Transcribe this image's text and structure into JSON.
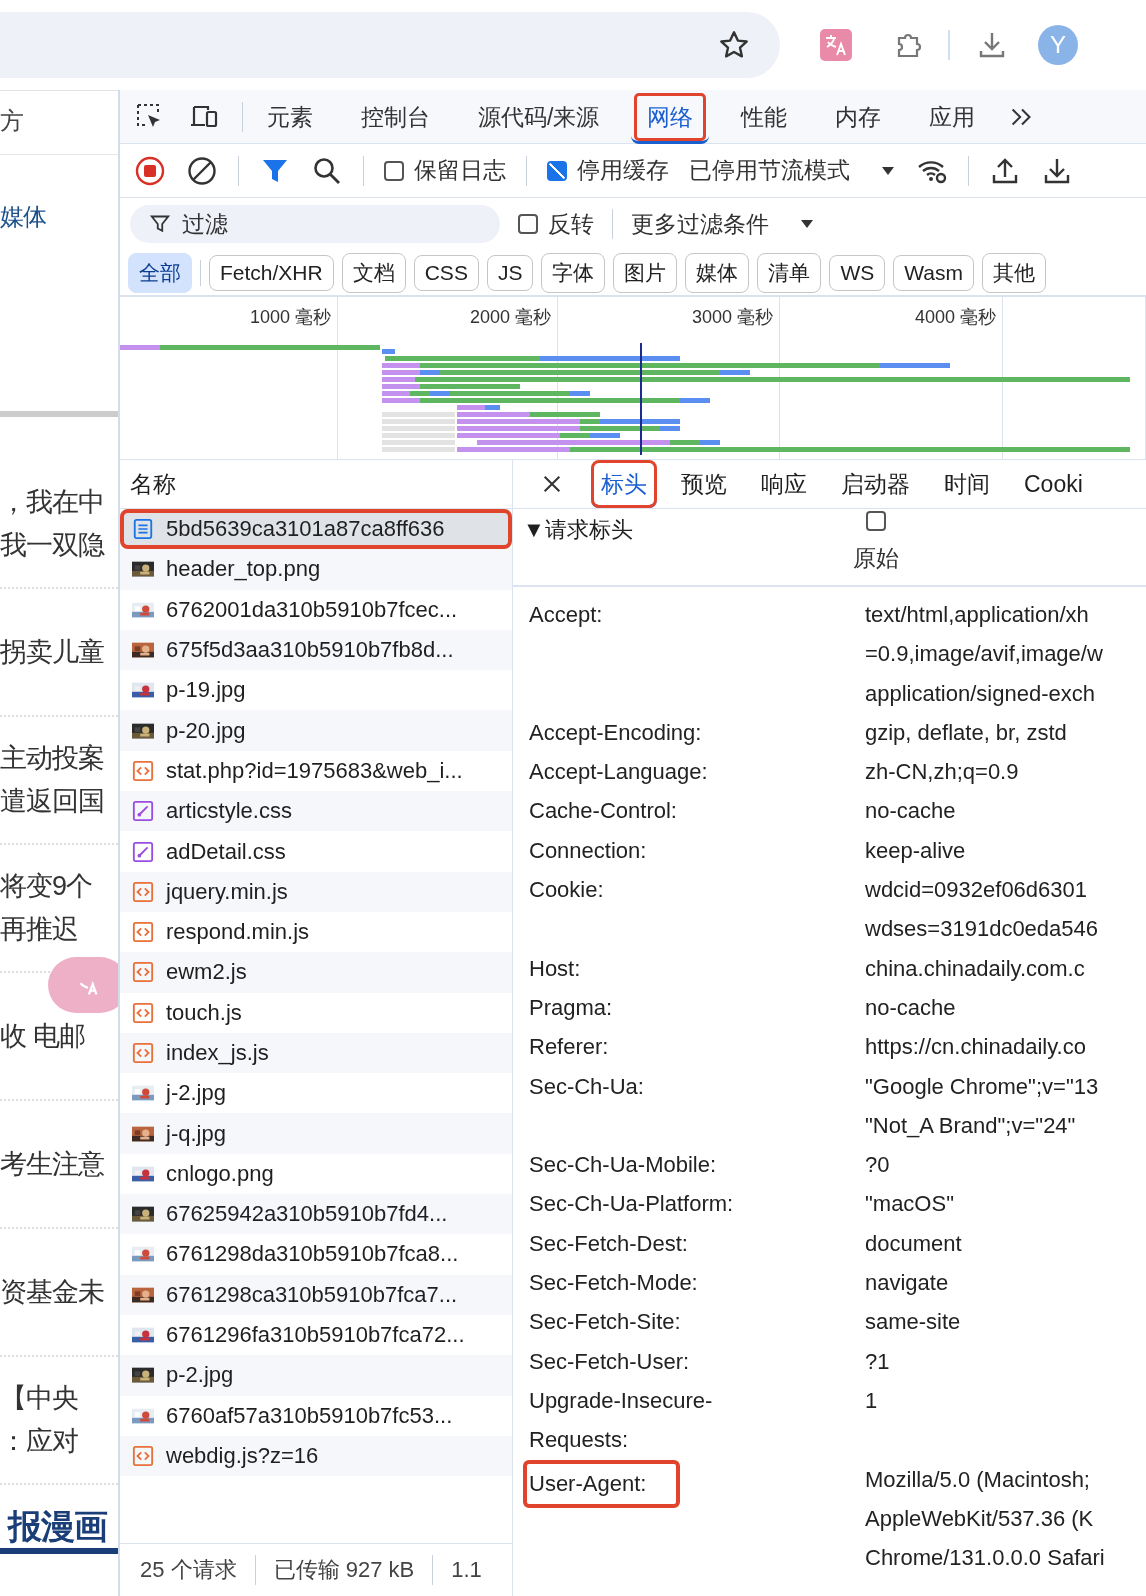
{
  "browser": {
    "avatar": "Y"
  },
  "page_fragments": [
    {
      "lines": [
        "方"
      ],
      "kind": "nav"
    },
    {
      "lines": [
        "媒体"
      ],
      "kind": "link"
    },
    {
      "kind": "rule"
    },
    {
      "lines": [
        "，我在中",
        "我一双隐"
      ],
      "kind": "headline"
    },
    {
      "lines": [
        "拐卖儿童"
      ],
      "kind": "headline"
    },
    {
      "lines": [
        "主动投案",
        "遣返回国"
      ],
      "kind": "headline"
    },
    {
      "lines": [
        "将变9个",
        "再推迟"
      ],
      "kind": "headline"
    },
    {
      "lines": [
        "收 电邮"
      ],
      "kind": "headline"
    },
    {
      "lines": [
        "考生注意"
      ],
      "kind": "headline"
    },
    {
      "lines": [
        "资基金未"
      ],
      "kind": "headline"
    },
    {
      "lines": [
        "【中央",
        "：应对"
      ],
      "kind": "headline"
    },
    {
      "lines": [
        "报漫画"
      ],
      "kind": "banner"
    }
  ],
  "devtools": {
    "panels": [
      {
        "label": "元素",
        "selected": false,
        "annotated": false
      },
      {
        "label": "控制台",
        "selected": false,
        "annotated": false
      },
      {
        "label": "源代码/来源",
        "selected": false,
        "annotated": false
      },
      {
        "label": "网络",
        "selected": true,
        "annotated": true
      },
      {
        "label": "性能",
        "selected": false,
        "annotated": false
      },
      {
        "label": "内存",
        "selected": false,
        "annotated": false
      },
      {
        "label": "应用",
        "selected": false,
        "annotated": false
      }
    ],
    "toolbar": {
      "preserve_log": {
        "label": "保留日志",
        "checked": false
      },
      "disable_cache": {
        "label": "停用缓存",
        "checked": true
      },
      "throttling": "已停用节流模式"
    },
    "filter": {
      "placeholder": "过滤",
      "invert": {
        "label": "反转",
        "checked": false
      },
      "more_filters": "更多过滤条件"
    },
    "type_filters": [
      {
        "label": "全部",
        "selected": true
      },
      {
        "label": "Fetch/XHR",
        "selected": false
      },
      {
        "label": "文档",
        "selected": false
      },
      {
        "label": "CSS",
        "selected": false
      },
      {
        "label": "JS",
        "selected": false
      },
      {
        "label": "字体",
        "selected": false
      },
      {
        "label": "图片",
        "selected": false
      },
      {
        "label": "媒体",
        "selected": false
      },
      {
        "label": "清单",
        "selected": false
      },
      {
        "label": "WS",
        "selected": false
      },
      {
        "label": "Wasm",
        "selected": false
      },
      {
        "label": "其他",
        "selected": false
      }
    ],
    "timeline_ticks": [
      "1000 毫秒",
      "2000 毫秒",
      "3000 毫秒",
      "4000 毫秒"
    ],
    "requests": {
      "column": "名称",
      "items": [
        {
          "name": "5bd5639ca3101a87ca8ff636",
          "kind": "document",
          "selected": true,
          "annotated": true
        },
        {
          "name": "header_top.png",
          "selected": false,
          "annotated": false
        },
        {
          "name": "6762001da310b5910b7fcec...",
          "selected": false,
          "annotated": false
        },
        {
          "name": "675f5d3aa310b5910b7fb8d...",
          "selected": false,
          "annotated": false
        },
        {
          "name": "p-19.jpg",
          "selected": false,
          "annotated": false
        },
        {
          "name": "p-20.jpg",
          "selected": false,
          "annotated": false
        },
        {
          "name": "stat.php?id=1975683&web_i...",
          "kind": "script",
          "selected": false,
          "annotated": false
        },
        {
          "name": "articstyle.css",
          "kind": "stylesheet",
          "selected": false,
          "annotated": false
        },
        {
          "name": "adDetail.css",
          "kind": "stylesheet",
          "selected": false,
          "annotated": false
        },
        {
          "name": "jquery.min.js",
          "kind": "script",
          "selected": false,
          "annotated": false
        },
        {
          "name": "respond.min.js",
          "kind": "script",
          "selected": false,
          "annotated": false
        },
        {
          "name": "ewm2.js",
          "kind": "script",
          "selected": false,
          "annotated": false
        },
        {
          "name": "touch.js",
          "kind": "script",
          "selected": false,
          "annotated": false
        },
        {
          "name": "index_js.js",
          "kind": "script",
          "selected": false,
          "annotated": false
        },
        {
          "name": "j-2.jpg",
          "selected": false,
          "annotated": false
        },
        {
          "name": "j-q.jpg",
          "selected": false,
          "annotated": false
        },
        {
          "name": "cnlogo.png",
          "selected": false,
          "annotated": false
        },
        {
          "name": "67625942a310b5910b7fd4...",
          "selected": false,
          "annotated": false
        },
        {
          "name": "6761298da310b5910b7fca8...",
          "selected": false,
          "annotated": false
        },
        {
          "name": "6761298ca310b5910b7fca7...",
          "selected": false,
          "annotated": false
        },
        {
          "name": "6761296fa310b5910b7fca72...",
          "selected": false,
          "annotated": false
        },
        {
          "name": "p-2.jpg",
          "selected": false,
          "annotated": false
        },
        {
          "name": "6760af57a310b5910b7fc53...",
          "selected": false,
          "annotated": false
        },
        {
          "name": "webdig.js?z=16",
          "kind": "script",
          "selected": false,
          "annotated": false
        }
      ]
    },
    "status_bar": [
      "25 个请求",
      "已传输 927 kB",
      "1.1"
    ],
    "details": {
      "tabs": [
        {
          "label": "标头",
          "selected": true,
          "annotated": true
        },
        {
          "label": "预览",
          "selected": false,
          "annotated": false
        },
        {
          "label": "响应",
          "selected": false,
          "annotated": false
        },
        {
          "label": "启动器",
          "selected": false,
          "annotated": false
        },
        {
          "label": "时间",
          "selected": false,
          "annotated": false
        },
        {
          "label": "Cooki",
          "selected": false,
          "annotated": false
        }
      ],
      "section": "▼请求标头",
      "raw": {
        "label": "原始",
        "checked": false
      },
      "headers": [
        {
          "name": "Accept:",
          "values": [
            "text/html,application/xh",
            "=0.9,image/avif,image/w",
            "application/signed-exch"
          ],
          "annotated": false
        },
        {
          "name": "Accept-Encoding:",
          "values": [
            "gzip, deflate, br, zstd"
          ],
          "annotated": false
        },
        {
          "name": "Accept-Language:",
          "values": [
            "zh-CN,zh;q=0.9"
          ],
          "annotated": false
        },
        {
          "name": "Cache-Control:",
          "values": [
            "no-cache"
          ],
          "annotated": false
        },
        {
          "name": "Connection:",
          "values": [
            "keep-alive"
          ],
          "annotated": false
        },
        {
          "name": "Cookie:",
          "values": [
            "wdcid=0932ef06d6301",
            "wdses=3191dc0eda546"
          ],
          "annotated": false
        },
        {
          "name": "Host:",
          "values": [
            "china.chinadaily.com.c"
          ],
          "annotated": false
        },
        {
          "name": "Pragma:",
          "values": [
            "no-cache"
          ],
          "annotated": false
        },
        {
          "name": "Referer:",
          "values": [
            "https://cn.chinadaily.co"
          ],
          "annotated": false
        },
        {
          "name": "Sec-Ch-Ua:",
          "values": [
            "\"Google Chrome\";v=\"13",
            "\"Not_A Brand\";v=\"24\""
          ],
          "annotated": false
        },
        {
          "name": "Sec-Ch-Ua-Mobile:",
          "values": [
            "?0"
          ],
          "annotated": false
        },
        {
          "name": "Sec-Ch-Ua-Platform:",
          "values": [
            "\"macOS\""
          ],
          "annotated": false
        },
        {
          "name": "Sec-Fetch-Dest:",
          "values": [
            "document"
          ],
          "annotated": false
        },
        {
          "name": "Sec-Fetch-Mode:",
          "values": [
            "navigate"
          ],
          "annotated": false
        },
        {
          "name": "Sec-Fetch-Site:",
          "values": [
            "same-site"
          ],
          "annotated": false
        },
        {
          "name": "Sec-Fetch-User:",
          "values": [
            "?1"
          ],
          "annotated": false
        },
        {
          "name": "Upgrade-Insecure-Requests:",
          "values": [
            "1"
          ],
          "annotated": false
        },
        {
          "name": "User-Agent:",
          "values": [
            "Mozilla/5.0 (Macintosh;",
            "AppleWebKit/537.36 (K",
            "Chrome/131.0.0.0 Safari"
          ],
          "annotated": true
        }
      ]
    }
  }
}
